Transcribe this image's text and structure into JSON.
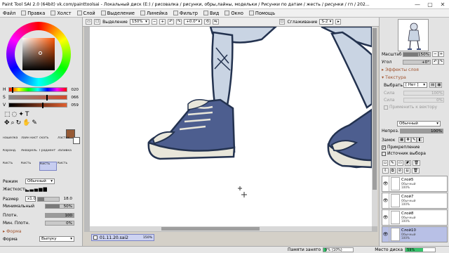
{
  "window": {
    "title": "Paint Tool SAI 2.0 (64bit) vk.com/painttoolsai - Локальный диск (E:) / рисовалка / рисунки, обры,лайны, модельки / Рисунки по датам / жесть / рисунки / гп / 202...",
    "min": "—",
    "max": "▢",
    "close": "✕"
  },
  "menu": [
    "Файл",
    "Правка",
    "Холст",
    "Слой",
    "Выделение",
    "Линейка",
    "Фильтр",
    "Вид",
    "Окно",
    "Помощь"
  ],
  "toolbar": {
    "selection_label": "Выделение",
    "zoom": "150%",
    "angle": "+0.0°",
    "smoothing_label": "Сглаживание",
    "smoothing_value": "S-2"
  },
  "color": {
    "h_label": "H",
    "s_label": "S",
    "v_label": "V",
    "h": "020",
    "s": "066",
    "v": "059",
    "h_frac": 0.06,
    "s_frac": 0.66,
    "v_frac": 0.59,
    "main": "#965a35",
    "secondary": "#ffffff"
  },
  "tools": [
    "нашелка",
    "лайн кист",
    "скать",
    "Ластик",
    "Каранд.",
    "Акварель",
    "Градиент",
    "Заливка",
    "Кисть",
    "Кисть",
    "Кисть",
    "Кисть"
  ],
  "brush": {
    "mode_label": "Режим",
    "mode_value": "Обычный",
    "hardness_label": "Жесткость",
    "size_label": "Размер",
    "size_mult": "x1.0",
    "size_value": "18.0",
    "min_label": "Минимальный",
    "min_value": "50%",
    "min_frac": 0.5,
    "density_label": "Плотн.",
    "density_value": "100",
    "density_frac": 1.0,
    "min_density_label": "Мин. Плотн.",
    "min_density_value": "0%",
    "min_density_frac": 0.0,
    "shape_header": "Форма",
    "shape_label": "Форма",
    "shape_value": "Выпуку"
  },
  "navigator": {
    "zoom_label": "Масштаб",
    "zoom_value": "150%",
    "angle_label": "Угол",
    "angle_value": "+0°"
  },
  "layer_panel": {
    "effects_header": "Эффекты слоя",
    "texture_header": "Текстура",
    "choose_label": "Выбрать",
    "choose_value": "[ Нет ]",
    "scale_label": "Сила",
    "scale_value": "100%",
    "strength_label": "Сила",
    "strength_value": "0%",
    "apply_vector": "Применить к вектору",
    "mode_value": "Обычный",
    "opacity_label": "Непроз.",
    "opacity_value": "100%",
    "opacity_frac": 1.0,
    "lock_label": "Замок",
    "clip_label": "Прикрепление",
    "source_label": "Источник выбора"
  },
  "layers": [
    {
      "name": "Слой5",
      "mode": "Обычный",
      "opacity": "100%"
    },
    {
      "name": "Слой7",
      "mode": "Обычный",
      "opacity": "100%"
    },
    {
      "name": "Слой8",
      "mode": "Обычный",
      "opacity": "100%"
    },
    {
      "name": "Слой10",
      "mode": "Обычный",
      "opacity": "100%"
    }
  ],
  "document_tab": {
    "name": "01.11.20.sai2",
    "zoom": "150%"
  },
  "status": {
    "mem_label": "Памяти занято",
    "mem_value": "9% (10%)",
    "disk_label": "Место диска",
    "disk_value": "59%",
    "mem_frac": 0.09,
    "disk_frac": 0.59
  }
}
